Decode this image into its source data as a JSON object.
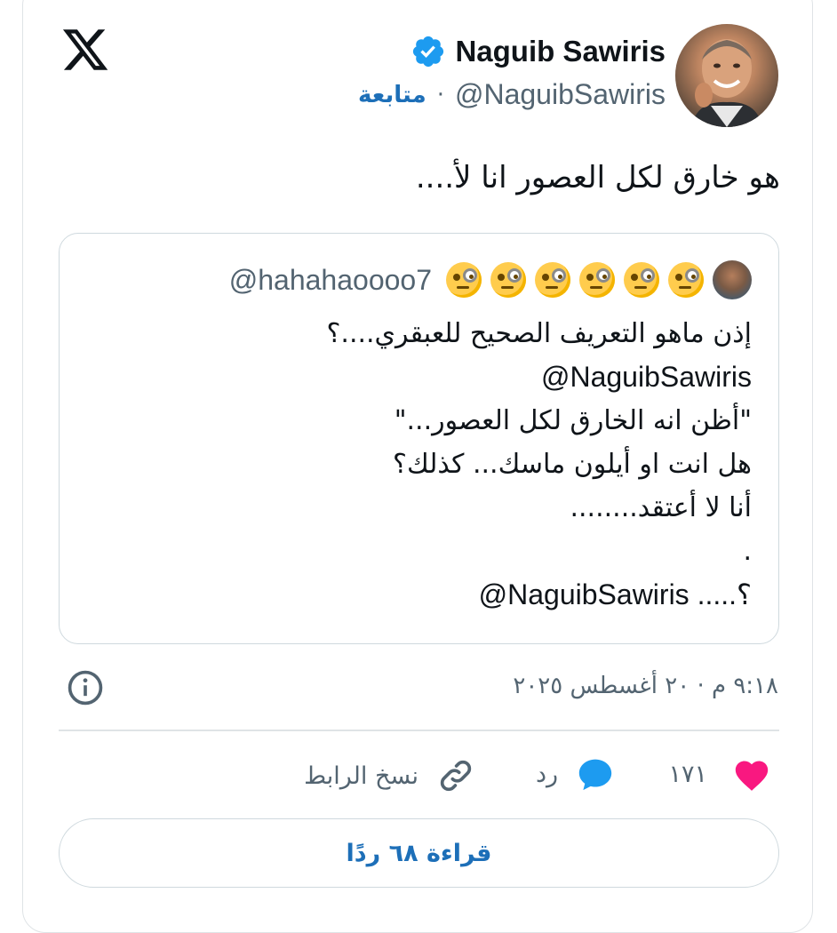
{
  "author": {
    "display_name": "Naguib Sawiris",
    "handle": "@NaguibSawiris",
    "verified": true,
    "follow_label": "متابعة"
  },
  "tweet": {
    "text": "هو خارق لكل العصور انا لأ...."
  },
  "quoted": {
    "handle": "@hahahaoooo7",
    "emoji": [
      "monocle-face",
      "monocle-face",
      "monocle-face",
      "monocle-face",
      "monocle-face",
      "monocle-face"
    ],
    "lines": [
      "إذن ماهو التعريف الصحيح للعبقري....؟",
      "@NaguibSawiris",
      "\"أظن انه الخارق لكل العصور...\"",
      "هل انت او أيلون ماسك... كذلك؟",
      "أنا لا أعتقد........",
      ".",
      "@NaguibSawiris  .....؟"
    ]
  },
  "meta": {
    "timestamp": "٩:١٨ م · ٢٠ أغسطس ٢٠٢٥"
  },
  "actions": {
    "like_count": "١٧١",
    "reply_label": "رد",
    "copy_link_label": "نسخ الرابط"
  },
  "read_replies_label": "قراءة ٦٨ ردًا",
  "colors": {
    "link_blue": "#1d6fb8",
    "verified_blue": "#1d9bf0",
    "like_pink": "#f91880",
    "text_gray": "#536471"
  }
}
